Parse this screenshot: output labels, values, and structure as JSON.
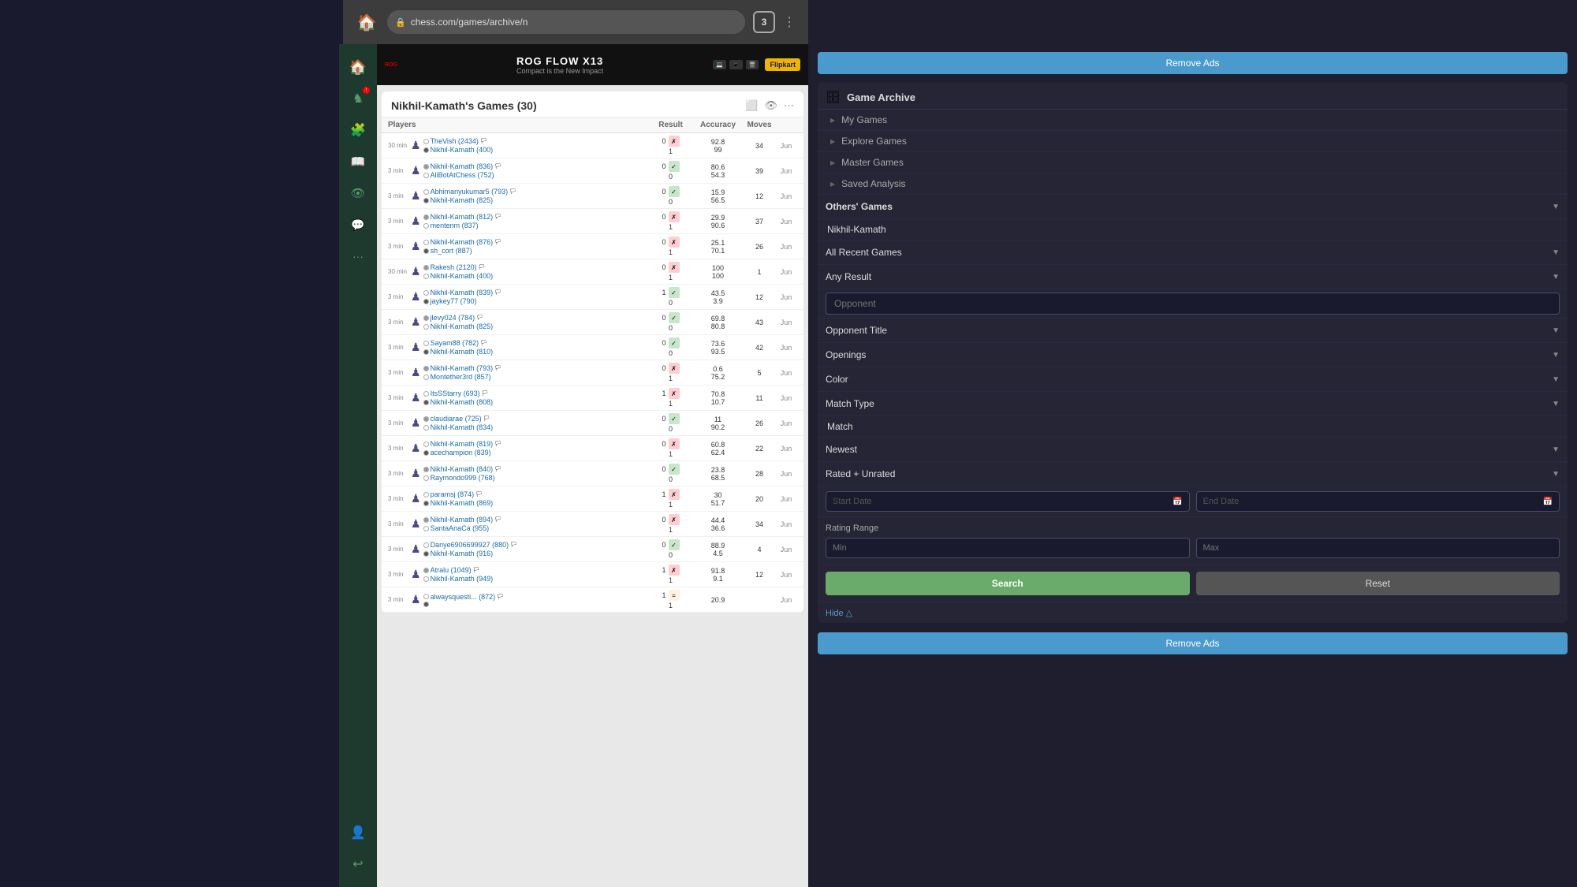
{
  "browser": {
    "url": "chess.com/games/archive/n",
    "tabs_count": "3"
  },
  "sidebar": {
    "nav_items": [
      {
        "id": "home",
        "icon": "🏠",
        "active": false
      },
      {
        "id": "puzzle",
        "icon": "🧩",
        "active": false
      },
      {
        "id": "game",
        "icon": "♟",
        "active": false
      },
      {
        "id": "learn",
        "icon": "📚",
        "active": false
      },
      {
        "id": "social",
        "icon": "💬",
        "active": false
      },
      {
        "id": "more",
        "icon": "···",
        "active": false
      },
      {
        "id": "profile",
        "icon": "👤",
        "active": false
      },
      {
        "id": "arrow",
        "icon": "↩",
        "active": false
      }
    ]
  },
  "ad": {
    "brand": "ROG",
    "title": "ROG FLOW X13",
    "subtitle": "Compact is the New Impact",
    "partner": "Flipkart"
  },
  "archive": {
    "title": "Nikhil-Kamath's Games (30)",
    "table": {
      "columns": [
        "Players",
        "Result",
        "Accuracy",
        "Moves",
        ""
      ],
      "rows": [
        {
          "time": "30 min",
          "p1": "TheVish (2434)",
          "p2": "Nikhil-Kamath (400)",
          "score1": "0",
          "score2": "1",
          "acc1": "92.8",
          "acc2": "99",
          "moves": "34",
          "month": "Jun",
          "result": "loss"
        },
        {
          "time": "3 min",
          "p1": "Nikhil-Kamath (836)",
          "p2": "AliBotAtChess (752)",
          "score1": "0",
          "score2": "",
          "acc1": "80.6",
          "acc2": "54.3",
          "moves": "39",
          "month": "Jun",
          "result": "win"
        },
        {
          "time": "3 min",
          "p1": "Abhimanyukumar5 (793)",
          "p2": "Nikhil-Kamath (825)",
          "score1": "0",
          "score2": "",
          "acc1": "15.9",
          "acc2": "56.5",
          "moves": "12",
          "month": "Jun",
          "result": "win"
        },
        {
          "time": "3 min",
          "p1": "Nikhil-Kamath (812)",
          "p2": "mentenm (837)",
          "score1": "0",
          "score2": "",
          "acc1": "29.9",
          "acc2": "90.6",
          "moves": "37",
          "month": "Jun",
          "result": "loss"
        },
        {
          "time": "3 min",
          "p1": "Nikhil-Kamath (876)",
          "p2": "sh_cort (887)",
          "score1": "0",
          "score2": "1",
          "acc1": "25.1",
          "acc2": "70.1",
          "moves": "26",
          "month": "Jun",
          "result": "loss"
        },
        {
          "time": "30 min",
          "p1": "Rakesh (2120)",
          "p2": "Nikhil-Kamath (400)",
          "score1": "0",
          "score2": "1",
          "acc1": "100",
          "acc2": "100",
          "moves": "1",
          "month": "Jun",
          "result": "loss"
        },
        {
          "time": "3 min",
          "p1": "Nikhil-Kamath (839)",
          "p2": "jaykey77 (790)",
          "score1": "1",
          "score2": "",
          "acc1": "43.5",
          "acc2": "3.9",
          "moves": "12",
          "month": "Jun",
          "result": "win"
        },
        {
          "time": "3 min",
          "p1": "jlevy024 (784)",
          "p2": "Nikhil-Kamath (825)",
          "score1": "0",
          "score2": "",
          "acc1": "69.8",
          "acc2": "80.8",
          "moves": "43",
          "month": "Jun",
          "result": "win"
        },
        {
          "time": "3 min",
          "p1": "Sayam88 (782)",
          "p2": "Nikhil-Kamath (810)",
          "score1": "0",
          "score2": "",
          "acc1": "73.6",
          "acc2": "93.5",
          "moves": "42",
          "month": "Jun",
          "result": "win"
        },
        {
          "time": "3 min",
          "p1": "Nikhil-Kamath (793)",
          "p2": "Montether3rd (857)",
          "score1": "0",
          "score2": "1",
          "acc1": "0.6",
          "acc2": "75.2",
          "moves": "5",
          "month": "Jun",
          "result": "loss"
        },
        {
          "time": "3 min",
          "p1": "ItsSStarry (693)",
          "p2": "Nikhil-Kamath (808)",
          "score1": "1",
          "score2": "",
          "acc1": "70.8",
          "acc2": "10.7",
          "moves": "11",
          "month": "Jun",
          "result": "loss"
        },
        {
          "time": "3 min",
          "p1": "claudiarae (725)",
          "p2": "Nikhil-Kamath (834)",
          "score1": "0",
          "score2": "",
          "acc1": "11",
          "acc2": "90.2",
          "moves": "26",
          "month": "Jun",
          "result": "win"
        },
        {
          "time": "3 min",
          "p1": "Nikhil-Kamath (819)",
          "p2": "acechampion (839)",
          "score1": "0",
          "score2": "1",
          "acc1": "60.8",
          "acc2": "62.4",
          "moves": "22",
          "month": "Jun",
          "result": "loss"
        },
        {
          "time": "3 min",
          "p1": "Nikhil-Kamath (840)",
          "p2": "Raymondo999 (768)",
          "score1": "0",
          "score2": "",
          "acc1": "23.8",
          "acc2": "68.5",
          "moves": "28",
          "month": "Jun",
          "result": "win"
        },
        {
          "time": "3 min",
          "p1": "paramsj (874)",
          "p2": "Nikhil-Kamath (869)",
          "score1": "1",
          "score2": "",
          "acc1": "30",
          "acc2": "51.7",
          "moves": "20",
          "month": "Jun",
          "result": "loss"
        },
        {
          "time": "3 min",
          "p1": "Nikhil-Kamath (894)",
          "p2": "SantaAnaCa (955)",
          "score1": "0",
          "score2": "",
          "acc1": "44.4",
          "acc2": "36.6",
          "moves": "34",
          "month": "Jun",
          "result": "loss"
        },
        {
          "time": "3 min",
          "p1": "Danye6906699927 (880)",
          "p2": "Nikhil-Kamath (916)",
          "score1": "0",
          "score2": "",
          "acc1": "88.9",
          "acc2": "4.5",
          "moves": "4",
          "month": "Jun",
          "result": "win"
        },
        {
          "time": "3 min",
          "p1": "Atralu (1049)",
          "p2": "Nikhil-Kamath (949)",
          "score1": "1",
          "score2": "",
          "acc1": "91.8",
          "acc2": "9.1",
          "moves": "12",
          "month": "Jun",
          "result": "loss"
        },
        {
          "time": "3 min",
          "p1": "alwaysquesti... (872)",
          "p2": "",
          "score1": "",
          "score2": "",
          "acc1": "20.9",
          "acc2": "",
          "moves": "",
          "month": "Jun",
          "result": ""
        }
      ]
    }
  },
  "right_panel": {
    "remove_ads_label": "Remove Ads",
    "game_archive_title": "Game Archive",
    "menu_items": [
      {
        "label": "My Games",
        "arrow": "▶"
      },
      {
        "label": "Explore Games",
        "arrow": "▶"
      },
      {
        "label": "Master Games",
        "arrow": "▶"
      },
      {
        "label": "Saved Analysis",
        "arrow": "▶"
      }
    ],
    "others_games_label": "Others' Games",
    "username": "Nikhil-Kamath",
    "all_recent_games_label": "All Recent Games",
    "any_result_label": "Any Result",
    "opponent_placeholder": "Opponent",
    "opponent_title_label": "Opponent Title",
    "openings_label": "Openings",
    "color_label": "Color",
    "match_type_label": "Match Type",
    "match_label": "Match",
    "newest_label": "Newest",
    "rated_unrated_label": "Rated + Unrated",
    "start_date_placeholder": "Start Date",
    "end_date_placeholder": "End Date",
    "rating_min_placeholder": "Min",
    "rating_max_placeholder": "Max",
    "rating_range_label": "Rating Range",
    "search_btn_label": "Search",
    "reset_btn_label": "Reset",
    "hide_label": "Hide △",
    "remove_ads_bottom_label": "Remove Ads"
  }
}
